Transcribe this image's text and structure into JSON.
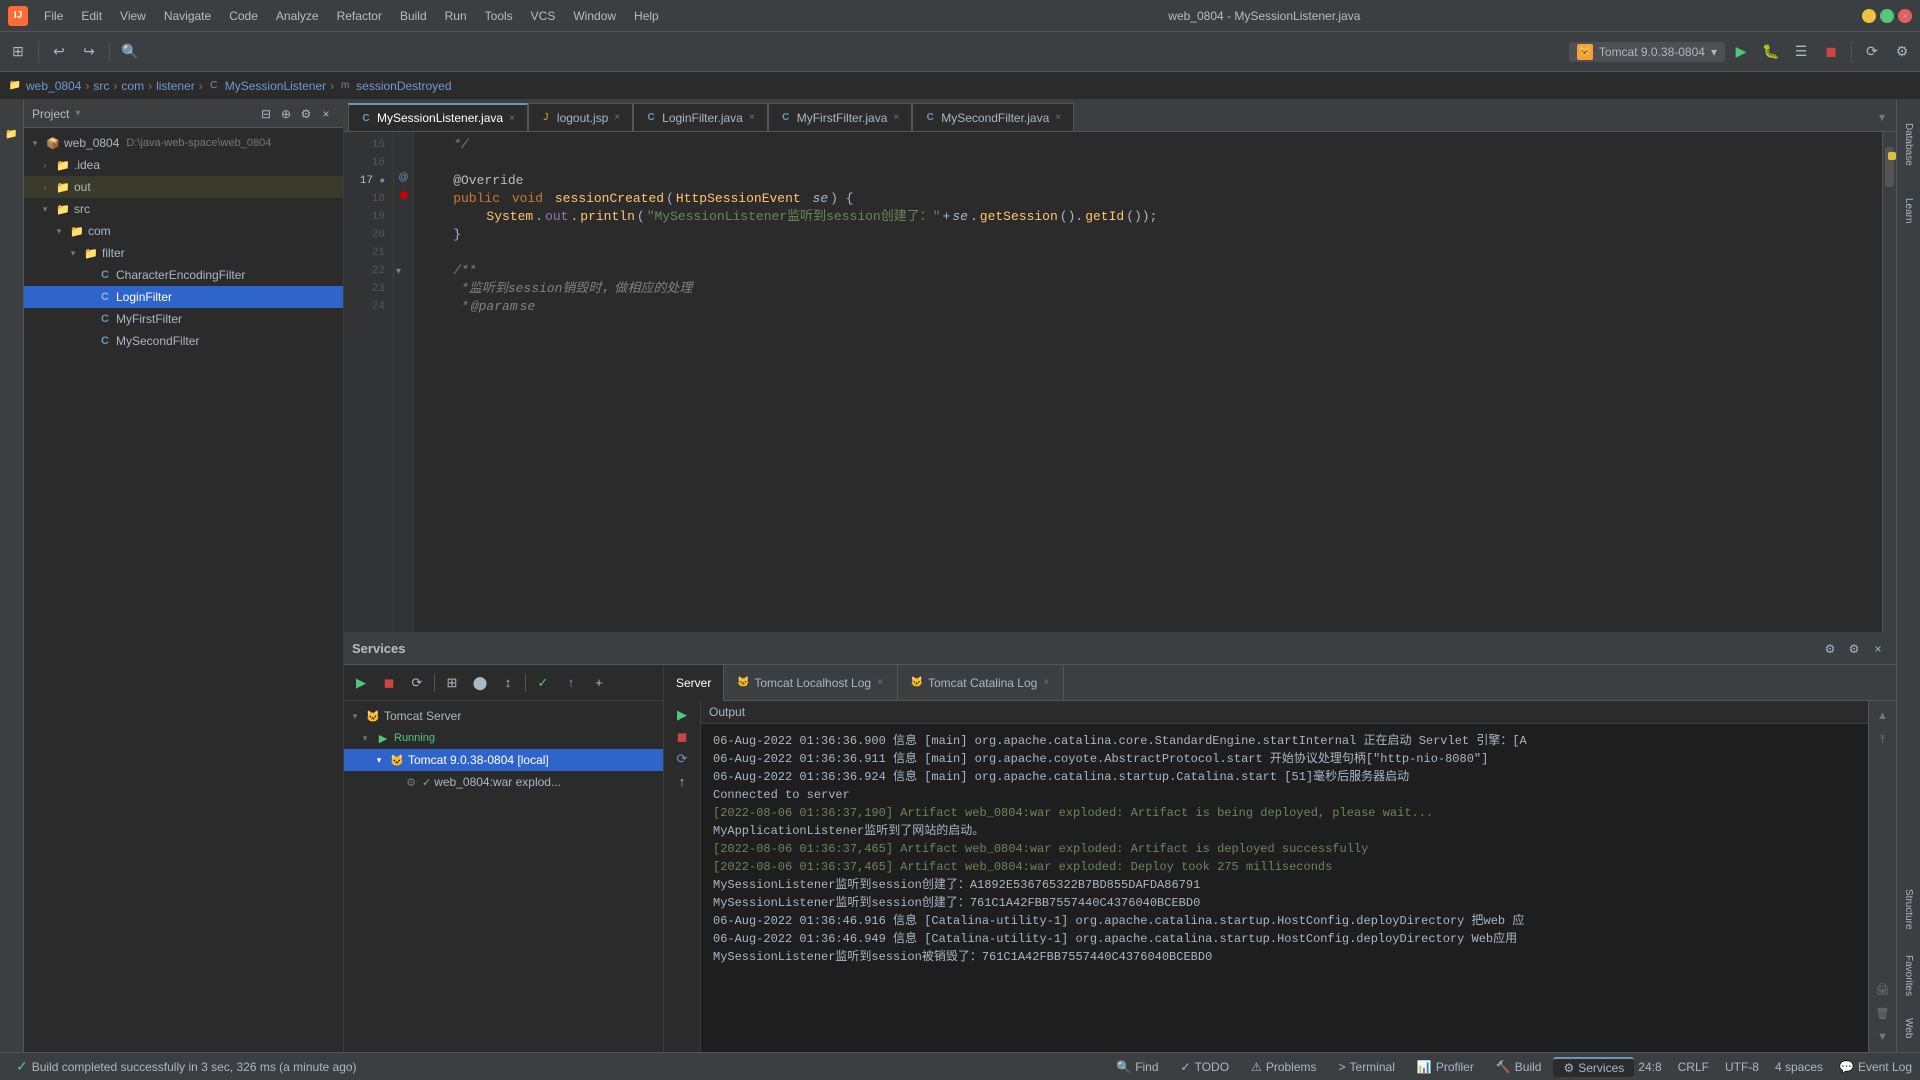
{
  "titleBar": {
    "logo": "IJ",
    "title": "web_0804 - MySessionListener.java",
    "menus": [
      "File",
      "Edit",
      "View",
      "Navigate",
      "Code",
      "Analyze",
      "Refactor",
      "Build",
      "Run",
      "Tools",
      "VCS",
      "Window",
      "Help"
    ],
    "controls": [
      "minimize",
      "maximize",
      "close"
    ]
  },
  "breadcrumb": {
    "items": [
      "web_0804",
      "src",
      "com",
      "listener",
      "MySessionListener",
      "sessionDestroyed"
    ]
  },
  "toolbar": {
    "runConfig": "Tomcat 9.0.38-0804"
  },
  "projectPanel": {
    "title": "Project",
    "root": {
      "name": "web_0804",
      "path": "D:\\java-web-space\\web_0804",
      "children": [
        {
          "name": ".idea",
          "type": "folder",
          "expanded": false,
          "indent": 1
        },
        {
          "name": "out",
          "type": "folder",
          "expanded": false,
          "indent": 1,
          "highlighted": true
        },
        {
          "name": "src",
          "type": "folder",
          "expanded": true,
          "indent": 1
        },
        {
          "name": "com",
          "type": "folder",
          "expanded": true,
          "indent": 2
        },
        {
          "name": "filter",
          "type": "folder",
          "expanded": true,
          "indent": 3
        },
        {
          "name": "CharacterEncodingFilter",
          "type": "java",
          "indent": 4
        },
        {
          "name": "LoginFilter",
          "type": "java",
          "indent": 4,
          "selected": true
        },
        {
          "name": "MyFirstFilter",
          "type": "java",
          "indent": 4
        },
        {
          "name": "MySecondFilter",
          "type": "java",
          "indent": 4
        }
      ]
    }
  },
  "editorTabs": [
    {
      "name": "MySessionListener.java",
      "icon": "C",
      "iconColor": "#6897bb",
      "active": true
    },
    {
      "name": "logout.jsp",
      "icon": "J",
      "iconColor": "#e0a030"
    },
    {
      "name": "LoginFilter.java",
      "icon": "C",
      "iconColor": "#6897bb"
    },
    {
      "name": "MyFirstFilter.java",
      "icon": "C",
      "iconColor": "#6897bb"
    },
    {
      "name": "MySecondFilter.java",
      "icon": "C",
      "iconColor": "#6897bb"
    }
  ],
  "codeLines": [
    {
      "num": 15,
      "content": "    */",
      "type": "comment"
    },
    {
      "num": 16,
      "content": ""
    },
    {
      "num": 17,
      "content": "    @Override",
      "type": "annotation",
      "hasGutter": true
    },
    {
      "num": 18,
      "content": "    public void sessionCreated(HttpSessionEvent se) {",
      "type": "code"
    },
    {
      "num": 19,
      "content": "        System.out.println(\"MySessionListener监听到session创建了：\"+se.getSession().getId());",
      "type": "code"
    },
    {
      "num": 20,
      "content": "    }",
      "type": "code"
    },
    {
      "num": 21,
      "content": ""
    },
    {
      "num": 22,
      "content": "    /**",
      "type": "comment"
    },
    {
      "num": 23,
      "content": "     *监听到session销毁时，做相应的处理",
      "type": "comment"
    },
    {
      "num": 24,
      "content": "     * @param se",
      "type": "comment"
    }
  ],
  "services": {
    "title": "Services",
    "tree": {
      "items": [
        {
          "name": "Tomcat Server",
          "type": "server",
          "indent": 0,
          "expanded": true
        },
        {
          "name": "Running",
          "type": "running",
          "indent": 1,
          "expanded": true
        },
        {
          "name": "Tomcat 9.0.38-0804 [local]",
          "type": "tomcat",
          "indent": 2,
          "selected": true,
          "expanded": true
        },
        {
          "name": "web_0804:war explod...",
          "type": "deploy",
          "indent": 3
        }
      ]
    },
    "outputTabs": [
      {
        "name": "Server",
        "active": true
      },
      {
        "name": "Tomcat Localhost Log",
        "closeable": true
      },
      {
        "name": "Tomcat Catalina Log",
        "closeable": true
      }
    ],
    "outputLabel": "Output",
    "outputLines": [
      {
        "text": "06-Aug-2022 01:36:36.900 信息 [main] org.apache.catalina.core.StandardEngine.startInternal 正在启动 Servlet 引擎：[A",
        "type": "info"
      },
      {
        "text": "06-Aug-2022 01:36:36.911 信息 [main] org.apache.coyote.AbstractProtocol.start 开始协议处理句柄[\"http-nio-8080\"]",
        "type": "info"
      },
      {
        "text": "06-Aug-2022 01:36:36.924 信息 [main] org.apache.catalina.startup.Catalina.start [51]毫秒后服务器启动",
        "type": "info"
      },
      {
        "text": "Connected to server",
        "type": "connected"
      },
      {
        "text": "[2022-08-06 01:36:37,190] Artifact web_0804:war exploded: Artifact is being deployed, please wait...",
        "type": "artifact"
      },
      {
        "text": "MyApplicationListener监听到了网站的启动。",
        "type": "session"
      },
      {
        "text": "[2022-08-06 01:36:37,465] Artifact web_0804:war exploded: Artifact is deployed successfully",
        "type": "artifact"
      },
      {
        "text": "[2022-08-06 01:36:37,465] Artifact web_0804:war exploded: Deploy took 275 milliseconds",
        "type": "artifact"
      },
      {
        "text": "MySessionListener监听到session创建了：A1892E536765322B7BD855DAFDA86791",
        "type": "session"
      },
      {
        "text": "MySessionListener监听到session创建了：761C1A42FBB7557440C4376040BCEBD0",
        "type": "session"
      },
      {
        "text": "06-Aug-2022 01:36:46.916 信息 [Catalina-utility-1] org.apache.catalina.startup.HostConfig.deployDirectory 把web 应",
        "type": "info"
      },
      {
        "text": "06-Aug-2022 01:36:46.949 信息 [Catalina-utility-1] org.apache.catalina.startup.HostConfig.deployDirectory Web应用",
        "type": "info"
      },
      {
        "text": "MySessionListener监听到session被销毁了：761C1A42FBB7557440C4376040BCEBD0",
        "type": "session"
      }
    ]
  },
  "bottomTabs": [
    {
      "name": "Find",
      "icon": "🔍"
    },
    {
      "name": "TODO",
      "icon": "✓"
    },
    {
      "name": "Problems",
      "icon": "⚠"
    },
    {
      "name": "Terminal",
      "icon": ">"
    },
    {
      "name": "Profiler",
      "icon": "📊"
    },
    {
      "name": "Build",
      "icon": "🔨"
    },
    {
      "name": "Services",
      "icon": "⚙",
      "active": true
    }
  ],
  "statusBar": {
    "buildMessage": "Build completed successfully in 3 sec, 326 ms (a minute ago)",
    "position": "24:8",
    "lineEnding": "CRLF",
    "encoding": "UTF-8",
    "indent": "4 spaces",
    "eventLog": "Event Log"
  }
}
